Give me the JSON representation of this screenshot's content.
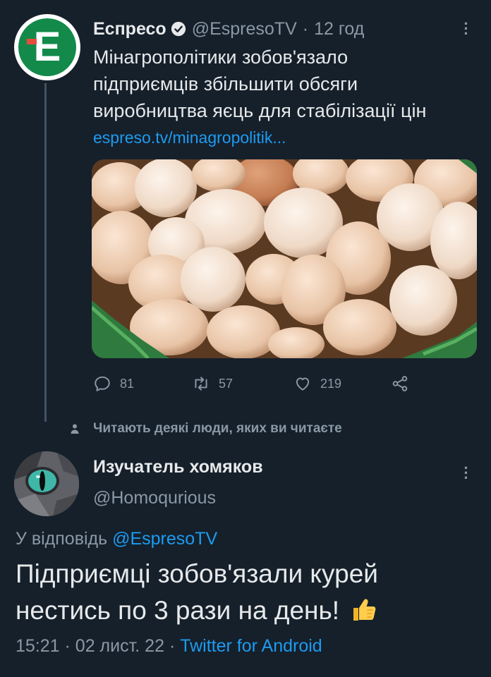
{
  "tweet": {
    "author_name": "Еспресо",
    "author_handle": "@EspresoTV",
    "separator": "·",
    "time": "12 год",
    "avatar_letter": "E",
    "text_lines": [
      "Мінагрополітики зобов'язало",
      "підприємців збільшити обсяги",
      "виробництва яєць для стабілізації цін"
    ],
    "link": "espreso.tv/minagropolitik...",
    "stats": {
      "replies": "81",
      "retweets": "57",
      "likes": "219"
    }
  },
  "social_context": "Читають деякі люди, яких ви читаєте",
  "reply": {
    "author_name": "Изучатель хомяков",
    "author_handle": "@Homoqurious",
    "reply_to_prefix": "У відповідь",
    "reply_to_handle": "@EspresoTV",
    "text_lines": [
      "Підприємці зобов'язали курей",
      "нестись по 3 рази на день!"
    ],
    "time": "15:21",
    "dot1": "·",
    "date": "02 лист. 22",
    "dot2": "·",
    "source": "Twitter for Android"
  },
  "colors": {
    "background": "#15202b",
    "primary_text": "#e7e9ea",
    "secondary_text": "#8b98a5",
    "accent": "#1d9bf0",
    "espreso_green": "#138a4a"
  },
  "icons": [
    "verified-badge-icon",
    "more-options-icon",
    "reply-icon",
    "retweet-icon",
    "like-icon",
    "share-icon",
    "person-icon",
    "thumbs-up-icon"
  ]
}
